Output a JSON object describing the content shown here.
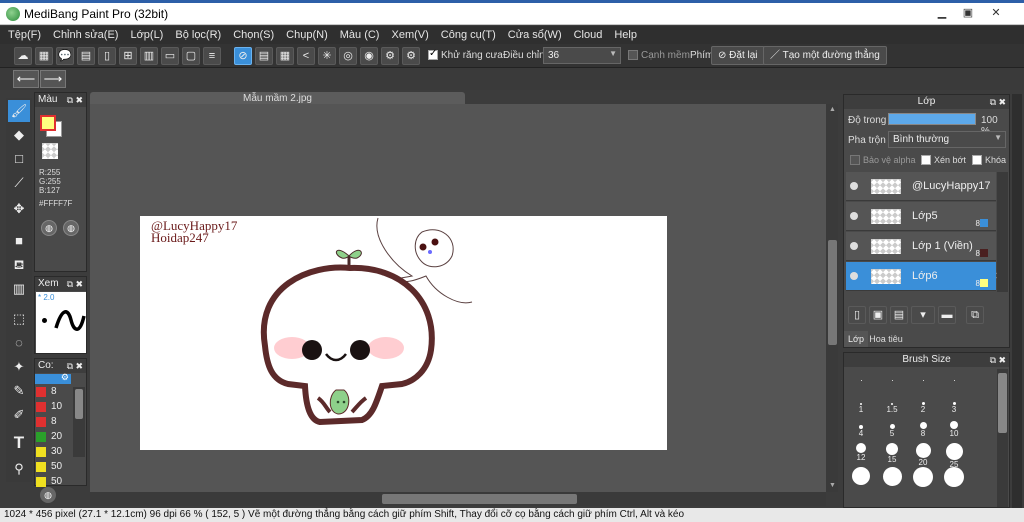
{
  "window": {
    "title": "MediBang Paint Pro (32bit)"
  },
  "menubar": [
    "Tệp(F)",
    "Chỉnh sửa(E)",
    "Lớp(L)",
    "Bộ lọc(R)",
    "Chọn(S)",
    "Chụp(N)",
    "Màu (C)",
    "Xem(V)",
    "Công cụ(T)",
    "Cửa sổ(W)",
    "Cloud",
    "Help"
  ],
  "toolbar": {
    "antialias_label": "Khử răng cưa",
    "adjust_label": "Điều chỉnh",
    "adjust_value": "36",
    "smooth_label": "Cạnh mềm",
    "key_label": "Phím",
    "reset_label": "Đặt lại",
    "line_label": "Tạo một đường thẳng"
  },
  "document": {
    "tab": "Mẫu mầm 2.jpg",
    "watermark_line1": "@LucyHappy17",
    "watermark_line2": "Hoidap247"
  },
  "color_panel": {
    "title": "Màu",
    "r": "R:255",
    "g": "G:255",
    "b": "B:127",
    "hex": "#FFFF7F"
  },
  "preview_panel": {
    "title": "Xem",
    "zoom": "* 2.0"
  },
  "brush_list_panel": {
    "title": "Co:",
    "items": [
      {
        "value": "8",
        "color": "#e03030"
      },
      {
        "value": "10",
        "color": "#e03030"
      },
      {
        "value": "8",
        "color": "#e03030"
      },
      {
        "value": "20",
        "color": "#2aa02a"
      },
      {
        "value": "30",
        "color": "#f0e020"
      },
      {
        "value": "50",
        "color": "#f0e020"
      },
      {
        "value": "50",
        "color": "#f0e020"
      }
    ]
  },
  "layer_panel": {
    "title": "Lớp",
    "opacity_label": "Độ trong",
    "opacity_value": "100 %",
    "blend_label": "Pha trộn",
    "blend_value": "Bình thường",
    "protect_alpha": "Bảo vệ alpha",
    "clipping": "Xén bớt",
    "lock": "Khóa",
    "layers": [
      {
        "name": "@LucyHappy17",
        "num": "",
        "swatch": ""
      },
      {
        "name": "Lớp5",
        "num": "8",
        "swatch": "#3a8fd9"
      },
      {
        "name": "Lớp 1 (Viền)",
        "num": "8",
        "swatch": "#4a2020"
      },
      {
        "name": "Lớp6",
        "num": "8",
        "swatch": "#ffff7f"
      }
    ],
    "tabs": [
      "Lớp",
      "Hoa tiêu"
    ]
  },
  "brush_size_panel": {
    "title": "Brush Size",
    "sizes": [
      "",
      "",
      "",
      "",
      "1",
      "1.5",
      "2",
      "3",
      "4",
      "5",
      "8",
      "10",
      "12",
      "15",
      "20",
      "25",
      "",
      "",
      "",
      ""
    ]
  },
  "statusbar": {
    "text": "1024 * 456 pixel   (27.1 * 12.1cm)   96 dpi   66 %   ( 152, 5 )   Vẽ một đường thẳng bằng cách giữ phím Shift, Thay đổi cỡ cọ bằng cách giữ phím Ctrl, Alt và kéo"
  },
  "colors": {
    "accent": "#3a8fd9",
    "primary": "#ffff7f",
    "secondary": "#ffffff"
  }
}
